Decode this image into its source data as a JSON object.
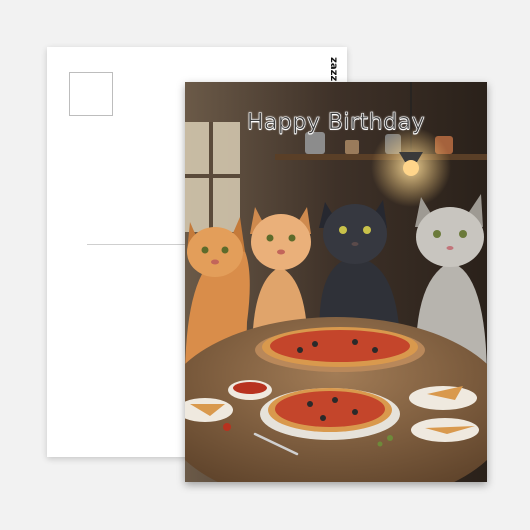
{
  "postcard": {
    "greeting": "Happy Birthday",
    "brand_mark": "zazzle"
  },
  "scene": {
    "subjects": [
      "orange-tabby-cat",
      "ginger-cat",
      "black-cat",
      "silver-tabby-cat"
    ],
    "food": [
      "pizza",
      "pizza",
      "pizza-slices",
      "tomato-sauce-bowl"
    ],
    "colors": {
      "background_wood": "#3b2e24",
      "table": "#7a5a3e",
      "pizza_crust": "#d9994d",
      "pizza_sauce": "#c4452b",
      "lamp_glow": "#ffcf7a"
    }
  }
}
